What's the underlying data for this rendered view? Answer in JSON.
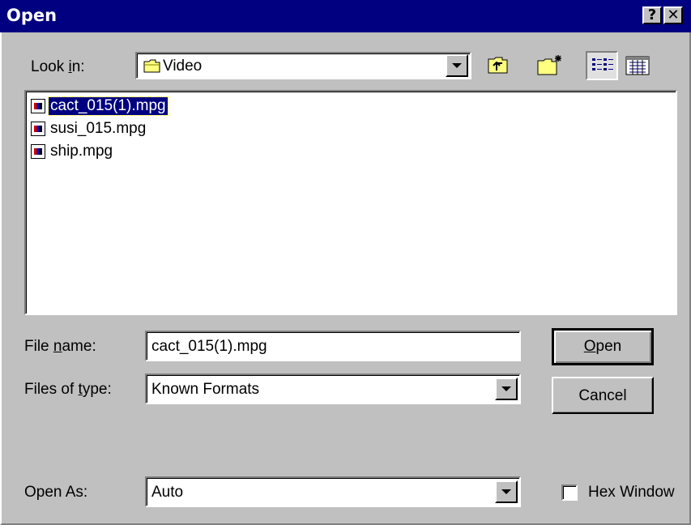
{
  "window": {
    "title": "Open",
    "help_btn": "?",
    "close_btn": "✕"
  },
  "lookin": {
    "label_pre": "Look ",
    "label_key": "i",
    "label_post": "n:",
    "value": "Video",
    "folder_icon": "folder-icon"
  },
  "files": [
    {
      "name": "cact_015(1).mpg",
      "selected": true
    },
    {
      "name": "susi_015.mpg",
      "selected": false
    },
    {
      "name": "ship.mpg",
      "selected": false
    }
  ],
  "filename": {
    "label_pre": "File ",
    "label_key": "n",
    "label_post": "ame:",
    "value": "cact_015(1).mpg"
  },
  "filetype": {
    "label_pre": "Files of ",
    "label_key": "t",
    "label_post": "ype:",
    "value": "Known Formats"
  },
  "openas": {
    "label": "Open As:",
    "value": "Auto"
  },
  "buttons": {
    "open_key": "O",
    "open_rest": "pen",
    "cancel": "Cancel"
  },
  "hex": {
    "label": "Hex Window",
    "checked": false
  },
  "colors": {
    "titlebar": "#000080",
    "face": "#c0c0c0",
    "selection": "#000080"
  }
}
